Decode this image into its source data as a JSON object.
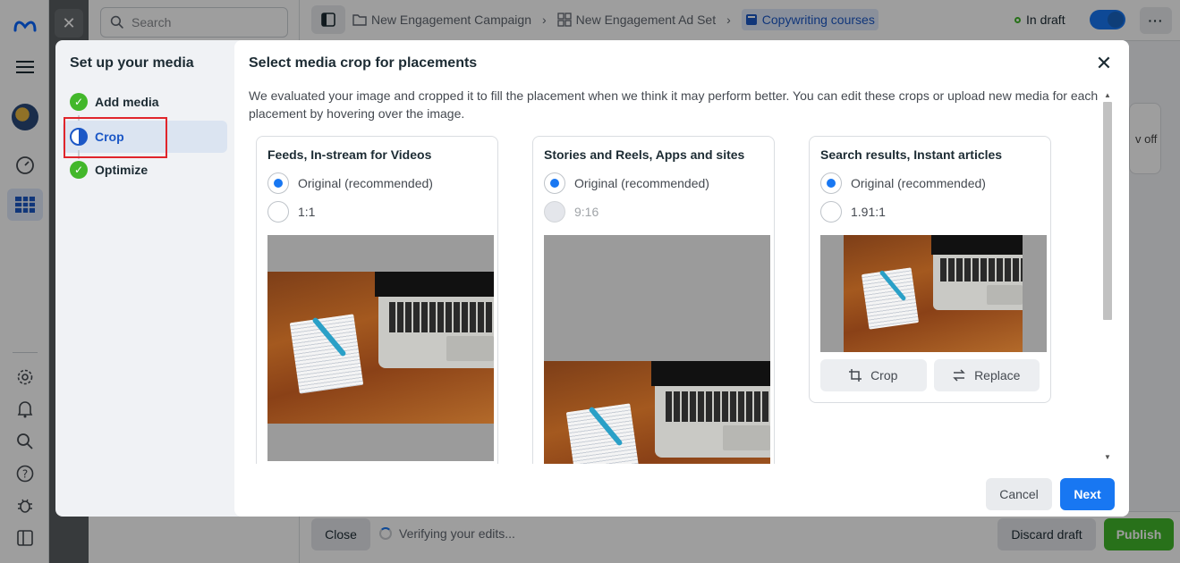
{
  "nav": {
    "icons": [
      "meta-logo-icon",
      "menu-icon",
      "avatar",
      "dashboard-icon",
      "table-icon",
      "settings-icon",
      "bell-icon",
      "search-icon",
      "help-icon",
      "bug-icon",
      "panel-icon"
    ]
  },
  "background": {
    "search_placeholder": "Search",
    "breadcrumbs": [
      {
        "label": "New Engagement Campaign"
      },
      {
        "label": "New Engagement Ad Set"
      },
      {
        "label": "Copywriting courses"
      }
    ],
    "status": "In draft",
    "card_text": "v off",
    "bottom": {
      "close_label": "Close",
      "verifying_text": "Verifying your edits...",
      "discard_label": "Discard draft",
      "publish_label": "Publish"
    }
  },
  "modal": {
    "sidebar_title": "Set up your media",
    "steps": [
      {
        "label": "Add media",
        "state": "done"
      },
      {
        "label": "Crop",
        "state": "current"
      },
      {
        "label": "Optimize",
        "state": "done"
      }
    ],
    "title": "Select media crop for placements",
    "description": "We evaluated your image and cropped it to fill the placement when we think it may perform better. You can edit these crops or upload new media for each placement by hovering over the image.",
    "placements": [
      {
        "title": "Feeds, In-stream for Videos",
        "options": [
          {
            "label": "Original (recommended)",
            "selected": true,
            "disabled": false
          },
          {
            "label": "1:1",
            "selected": false,
            "disabled": false
          }
        ]
      },
      {
        "title": "Stories and Reels, Apps and sites",
        "options": [
          {
            "label": "Original (recommended)",
            "selected": true,
            "disabled": false
          },
          {
            "label": "9:16",
            "selected": false,
            "disabled": true
          }
        ]
      },
      {
        "title": "Search results, Instant articles",
        "options": [
          {
            "label": "Original (recommended)",
            "selected": true,
            "disabled": false
          },
          {
            "label": "1.91:1",
            "selected": false,
            "disabled": false
          }
        ],
        "crop_label": "Crop",
        "replace_label": "Replace"
      }
    ],
    "footer": {
      "cancel_label": "Cancel",
      "next_label": "Next"
    },
    "colors": {
      "primary": "#1877f2",
      "success": "#42b72a",
      "highlight": "#e0252b"
    }
  }
}
